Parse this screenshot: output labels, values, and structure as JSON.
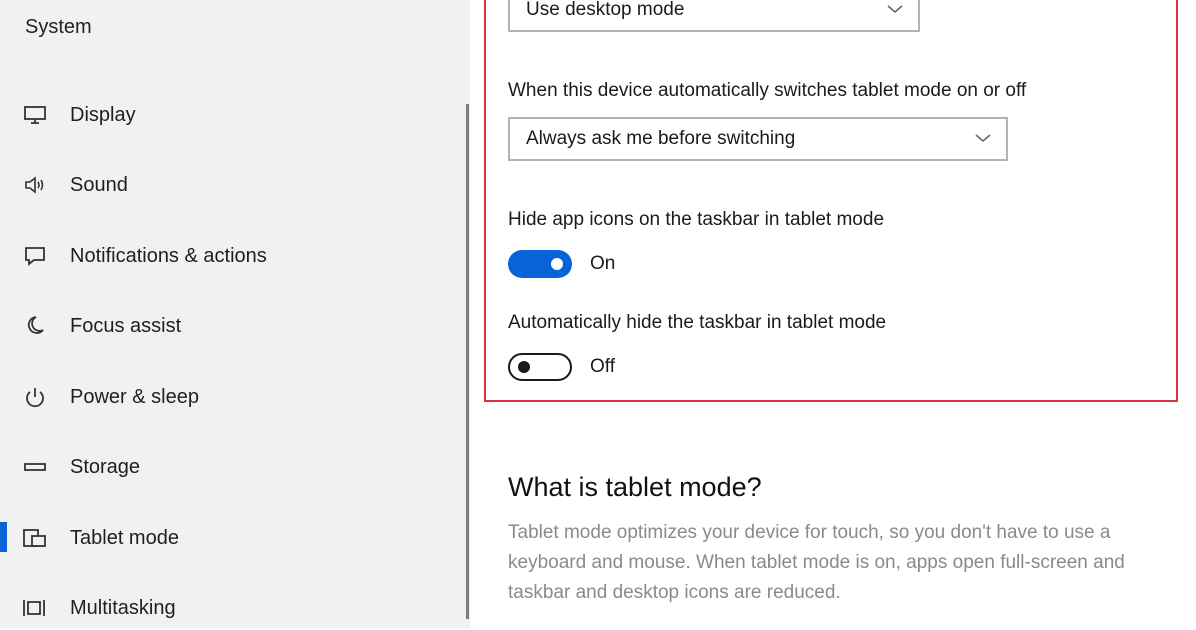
{
  "sidebar": {
    "title": "System",
    "items": [
      {
        "label": "Display",
        "icon": "monitor-icon"
      },
      {
        "label": "Sound",
        "icon": "speaker-icon"
      },
      {
        "label": "Notifications & actions",
        "icon": "notification-icon"
      },
      {
        "label": "Focus assist",
        "icon": "moon-icon"
      },
      {
        "label": "Power & sleep",
        "icon": "power-icon"
      },
      {
        "label": "Storage",
        "icon": "storage-icon"
      },
      {
        "label": "Tablet mode",
        "icon": "tablet-mode-icon",
        "selected": true
      },
      {
        "label": "Multitasking",
        "icon": "multitasking-icon"
      }
    ]
  },
  "main": {
    "signin_select": {
      "value": "Use desktop mode"
    },
    "switch_label": "When this device automatically switches tablet mode on or off",
    "switch_select": {
      "value": "Always ask me before switching"
    },
    "hide_icons": {
      "label": "Hide app icons on the taskbar in tablet mode",
      "state": "On",
      "on": true
    },
    "hide_taskbar": {
      "label": "Automatically hide the taskbar in tablet mode",
      "state": "Off",
      "on": false
    },
    "info": {
      "heading": "What is tablet mode?",
      "description": "Tablet mode optimizes your device for touch, so you don't have to use a keyboard and mouse. When tablet mode is on, apps open full-screen and taskbar and desktop icons are reduced."
    }
  },
  "colors": {
    "accent": "#0a63d6",
    "highlight_border": "#d9343f",
    "sidebar_bg": "#f1f1f1"
  }
}
